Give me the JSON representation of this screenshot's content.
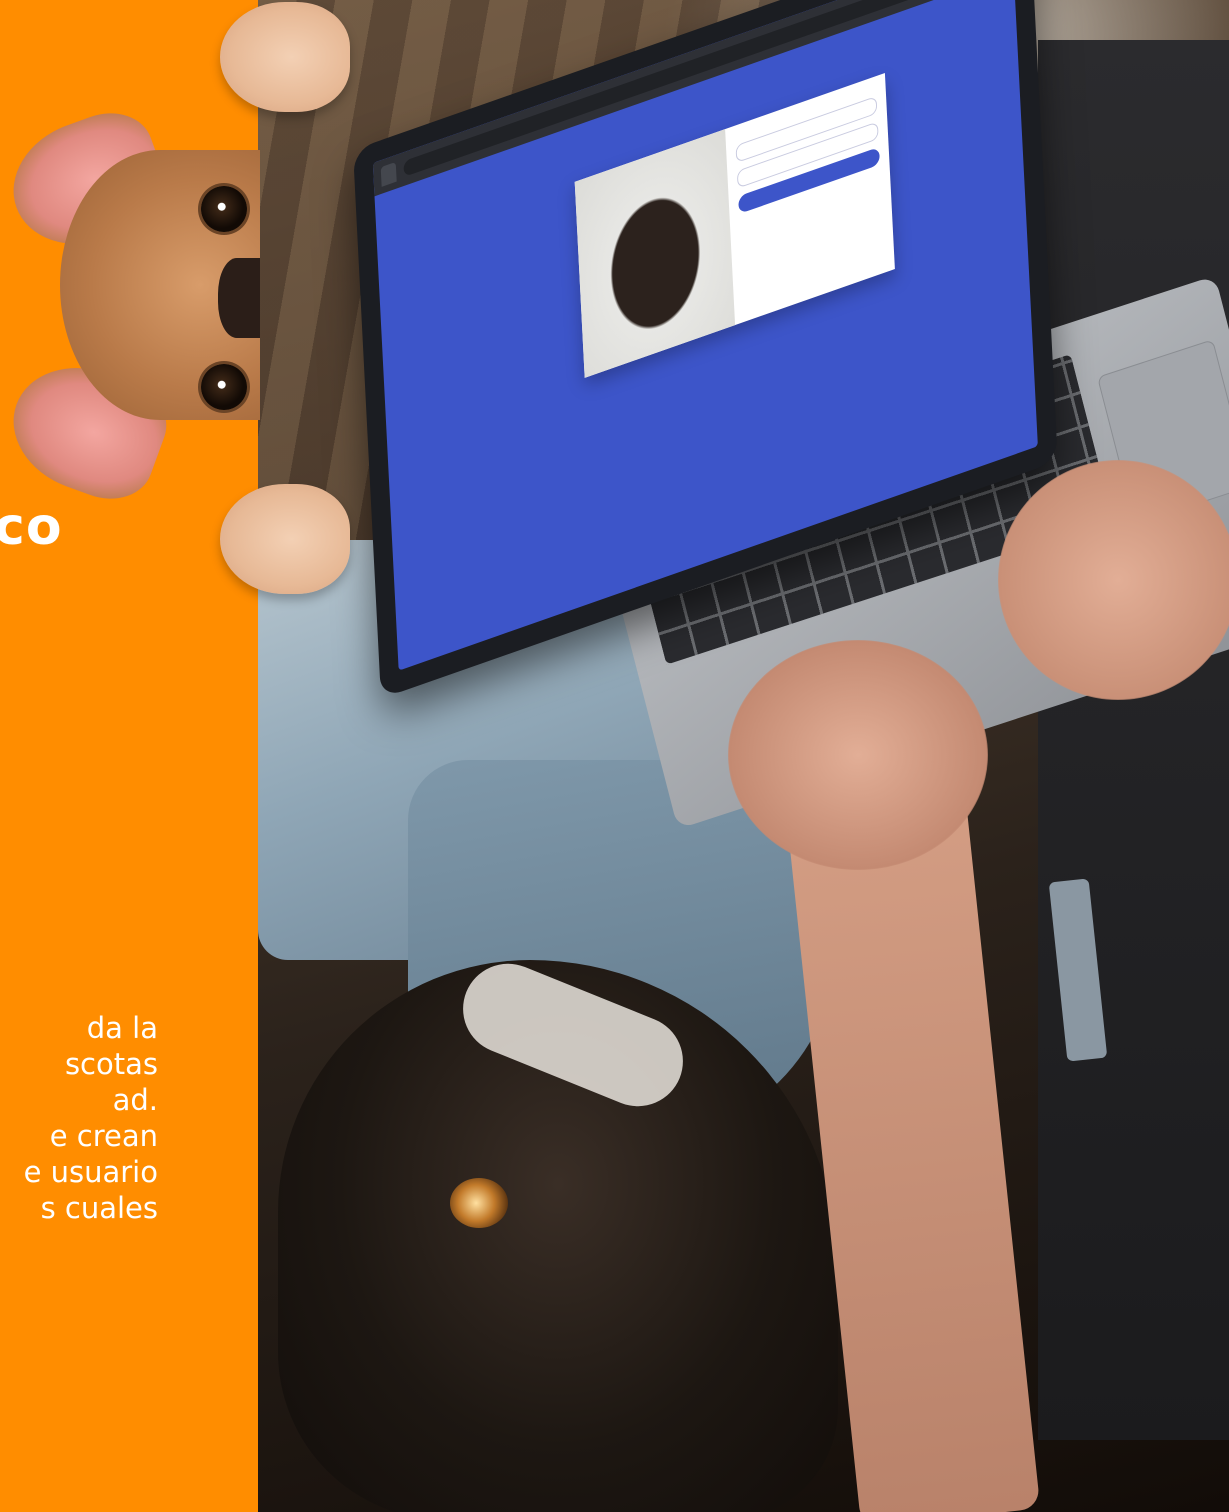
{
  "side": {
    "heading": "co",
    "body_lines": [
      "da la",
      "scotas",
      "ad.",
      "e crean",
      "e usuario",
      "s cuales"
    ]
  },
  "laptop": {
    "screen_color": "#3d55c9",
    "browser_tab": "",
    "address": "",
    "login": {
      "title": "",
      "username_placeholder": "",
      "password_placeholder": "",
      "button": "",
      "links": ""
    }
  },
  "colors": {
    "accent_orange": "#ff8d00",
    "screen_blue": "#3d55c9"
  }
}
